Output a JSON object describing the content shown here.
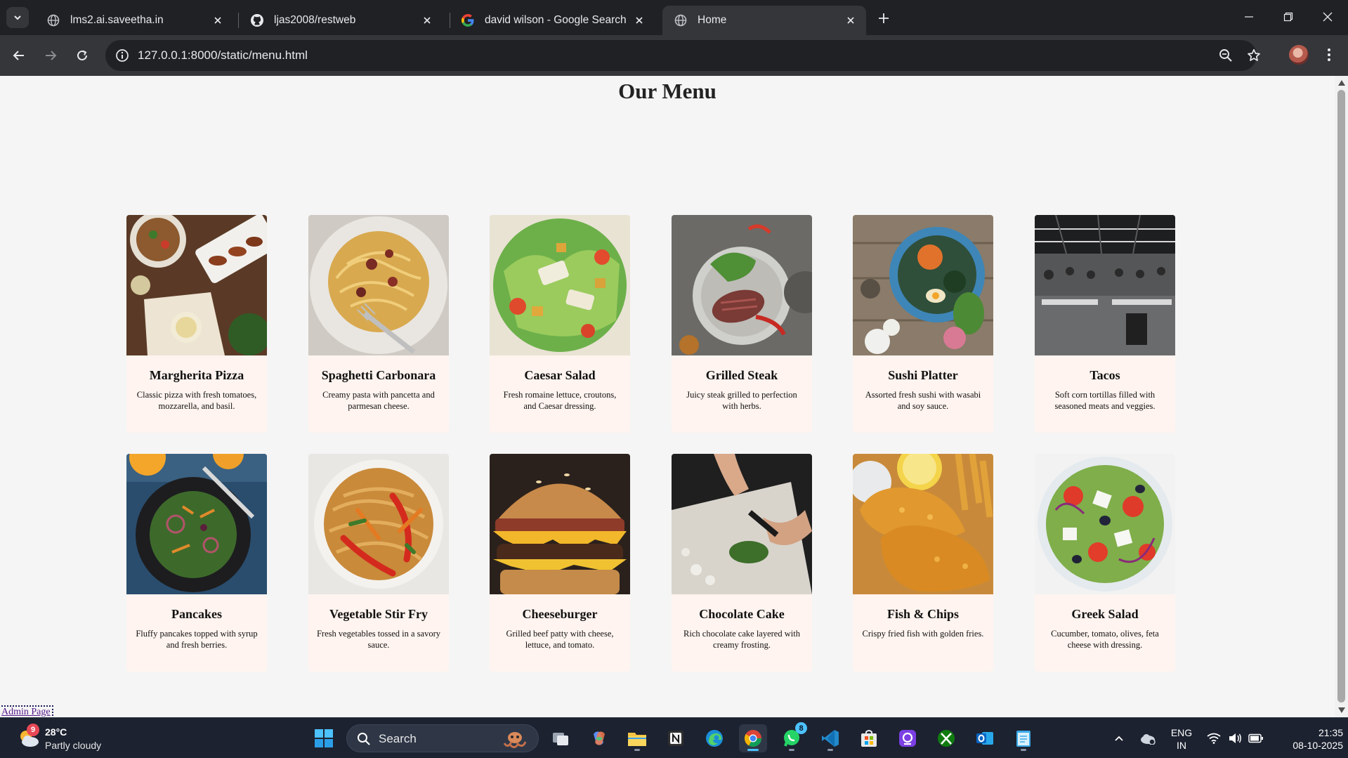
{
  "browser": {
    "tabs": [
      {
        "title": "lms2.ai.saveetha.in",
        "favicon": "globe-icon",
        "active": false
      },
      {
        "title": "ljas2008/restweb",
        "favicon": "github-icon",
        "active": false
      },
      {
        "title": "david wilson - Google Search",
        "favicon": "google-icon",
        "active": false
      },
      {
        "title": "Home",
        "favicon": "globe-icon",
        "active": true
      }
    ],
    "url": "127.0.0.1:8000/static/menu.html"
  },
  "page": {
    "title": "Our Menu",
    "admin_link": "Admin Page",
    "menu_items": [
      {
        "name": "Margherita Pizza",
        "description": "Classic pizza with fresh tomatoes, mozzarella, and basil.",
        "image": "food-spread-photo"
      },
      {
        "name": "Spaghetti Carbonara",
        "description": "Creamy pasta with pancetta and parmesan cheese.",
        "image": "spaghetti-photo"
      },
      {
        "name": "Caesar Salad",
        "description": "Fresh romaine lettuce, croutons, and Caesar dressing.",
        "image": "salad-photo"
      },
      {
        "name": "Grilled Steak",
        "description": "Juicy steak grilled to perfection with herbs.",
        "image": "steak-photo"
      },
      {
        "name": "Sushi Platter",
        "description": "Assorted fresh sushi with wasabi and soy sauce.",
        "image": "sushi-bowl-photo"
      },
      {
        "name": "Tacos",
        "description": "Soft corn tortillas filled with seasoned meats and veggies.",
        "image": "office-photo"
      },
      {
        "name": "Pancakes",
        "description": "Fluffy pancakes topped with syrup and fresh berries.",
        "image": "green-salad-photo"
      },
      {
        "name": "Vegetable Stir Fry",
        "description": "Fresh vegetables tossed in a savory sauce.",
        "image": "noodles-photo"
      },
      {
        "name": "Cheeseburger",
        "description": "Grilled beef patty with cheese, lettuce, and tomato.",
        "image": "burger-photo"
      },
      {
        "name": "Chocolate Cake",
        "description": "Rich chocolate cake layered with creamy frosting.",
        "image": "chopping-herbs-photo"
      },
      {
        "name": "Fish & Chips",
        "description": "Crispy fried fish with golden fries.",
        "image": "fried-fish-photo"
      },
      {
        "name": "Greek Salad",
        "description": "Cucumber, tomato, olives, feta cheese with dressing.",
        "image": "greek-salad-photo"
      }
    ]
  },
  "taskbar": {
    "weather": {
      "temp": "28°C",
      "condition": "Partly cloudy",
      "badge": "9"
    },
    "search_label": "Search",
    "whatsapp_badge": "8",
    "language": [
      "ENG",
      "IN"
    ],
    "time": "21:35",
    "date": "08-10-2025"
  },
  "colors": {
    "card_background": "#fff4ef",
    "page_background": "#f5f5f5",
    "chrome_dark": "#202124",
    "taskbar": "#1c2230"
  }
}
